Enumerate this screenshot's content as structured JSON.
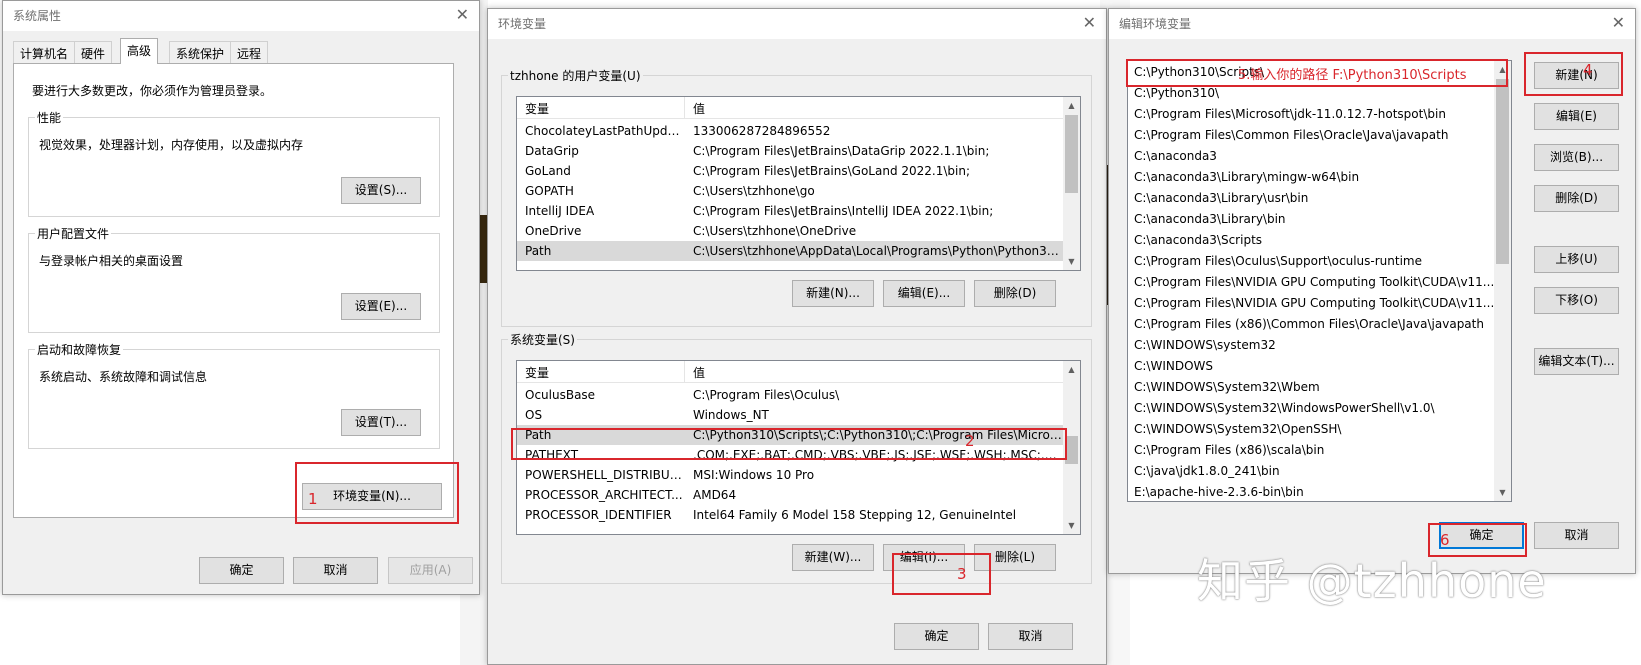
{
  "sysprops": {
    "title": "系统属性",
    "close": "✕",
    "tabs": [
      "计算机名",
      "硬件",
      "高级",
      "系统保护",
      "远程"
    ],
    "admin_note": "要进行大多数更改，你必须作为管理员登录。",
    "perf": {
      "title": "性能",
      "desc": "视觉效果，处理器计划，内存使用，以及虚拟内存",
      "btn": "设置(S)..."
    },
    "profile": {
      "title": "用户配置文件",
      "desc": "与登录帐户相关的桌面设置",
      "btn": "设置(E)..."
    },
    "startup": {
      "title": "启动和故障恢复",
      "desc": "系统启动、系统故障和调试信息",
      "btn": "设置(T)..."
    },
    "env_btn": "环境变量(N)...",
    "ok": "确定",
    "cancel": "取消",
    "apply": "应用(A)"
  },
  "envvars": {
    "title": "环境变量",
    "close": "✕",
    "user_group": "tzhhone 的用户变量(U)",
    "col_var": "变量",
    "col_val": "值",
    "user_rows": [
      {
        "name": "ChocolateyLastPathUpdate",
        "value": "133006287284896552"
      },
      {
        "name": "DataGrip",
        "value": "C:\\Program Files\\JetBrains\\DataGrip 2022.1.1\\bin;"
      },
      {
        "name": "GoLand",
        "value": "C:\\Program Files\\JetBrains\\GoLand 2022.1\\bin;"
      },
      {
        "name": "GOPATH",
        "value": "C:\\Users\\tzhhone\\go"
      },
      {
        "name": "IntelliJ IDEA",
        "value": "C:\\Program Files\\JetBrains\\IntelliJ IDEA 2022.1\\bin;"
      },
      {
        "name": "OneDrive",
        "value": "C:\\Users\\tzhhone\\OneDrive"
      },
      {
        "name": "Path",
        "value": "C:\\Users\\tzhhone\\AppData\\Local\\Programs\\Python\\Python39..."
      }
    ],
    "user_btns": [
      "新建(N)...",
      "编辑(E)...",
      "删除(D)"
    ],
    "sys_group": "系统变量(S)",
    "sys_rows": [
      {
        "name": "OculusBase",
        "value": "C:\\Program Files\\Oculus\\"
      },
      {
        "name": "OS",
        "value": "Windows_NT"
      },
      {
        "name": "Path",
        "value": "C:\\Python310\\Scripts\\;C:\\Python310\\;C:\\Program Files\\Micros..."
      },
      {
        "name": "PATHEXT",
        "value": ".COM;.EXE;.BAT;.CMD;.VBS;.VBE;.JS;.JSE;.WSF;.WSH;.MSC;.PY;.P..."
      },
      {
        "name": "POWERSHELL_DISTRIBUTI...",
        "value": "MSI:Windows 10 Pro"
      },
      {
        "name": "PROCESSOR_ARCHITECT...",
        "value": "AMD64"
      },
      {
        "name": "PROCESSOR_IDENTIFIER",
        "value": "Intel64 Family 6 Model 158 Stepping 12, GenuineIntel"
      }
    ],
    "sys_btns": [
      "新建(W)...",
      "编辑(I)...",
      "删除(L)"
    ],
    "ok": "确定",
    "cancel": "取消"
  },
  "editenv": {
    "title": "编辑环境变量",
    "close": "✕",
    "entries": [
      "C:\\Python310\\Scripts\\",
      "C:\\Python310\\",
      "C:\\Program Files\\Microsoft\\jdk-11.0.12.7-hotspot\\bin",
      "C:\\Program Files\\Common Files\\Oracle\\Java\\javapath",
      "C:\\anaconda3",
      "C:\\anaconda3\\Library\\mingw-w64\\bin",
      "C:\\anaconda3\\Library\\usr\\bin",
      "C:\\anaconda3\\Library\\bin",
      "C:\\anaconda3\\Scripts",
      "C:\\Program Files\\Oculus\\Support\\oculus-runtime",
      "C:\\Program Files\\NVIDIA GPU Computing Toolkit\\CUDA\\v11....",
      "C:\\Program Files\\NVIDIA GPU Computing Toolkit\\CUDA\\v11....",
      "C:\\Program Files (x86)\\Common Files\\Oracle\\Java\\javapath",
      "C:\\WINDOWS\\system32",
      "C:\\WINDOWS",
      "C:\\WINDOWS\\System32\\Wbem",
      "C:\\WINDOWS\\System32\\WindowsPowerShell\\v1.0\\",
      "C:\\WINDOWS\\System32\\OpenSSH\\",
      "C:\\Program Files (x86)\\scala\\bin",
      "C:\\java\\jdk1.8.0_241\\bin",
      "E:\\apache-hive-2.3.6-bin\\bin"
    ],
    "btns": {
      "new": "新建(N)",
      "edit": "编辑(E)",
      "browse": "浏览(B)...",
      "delete": "删除(D)",
      "up": "上移(U)",
      "down": "下移(O)",
      "edit_text": "编辑文本(T)..."
    },
    "ok": "确定",
    "cancel": "取消"
  },
  "annotations": {
    "n1": "1",
    "n2": "2",
    "n3": "3",
    "n4": "4",
    "n6": "6",
    "n5_text": "5.输入你的路径 F:\\Python310\\Scripts"
  },
  "watermark": "知乎 @tzhhone",
  "colors": {
    "annotation_red": "#d9262c",
    "dialog_bg": "#f0f0f0",
    "selected_row": "#d9d9d9"
  }
}
